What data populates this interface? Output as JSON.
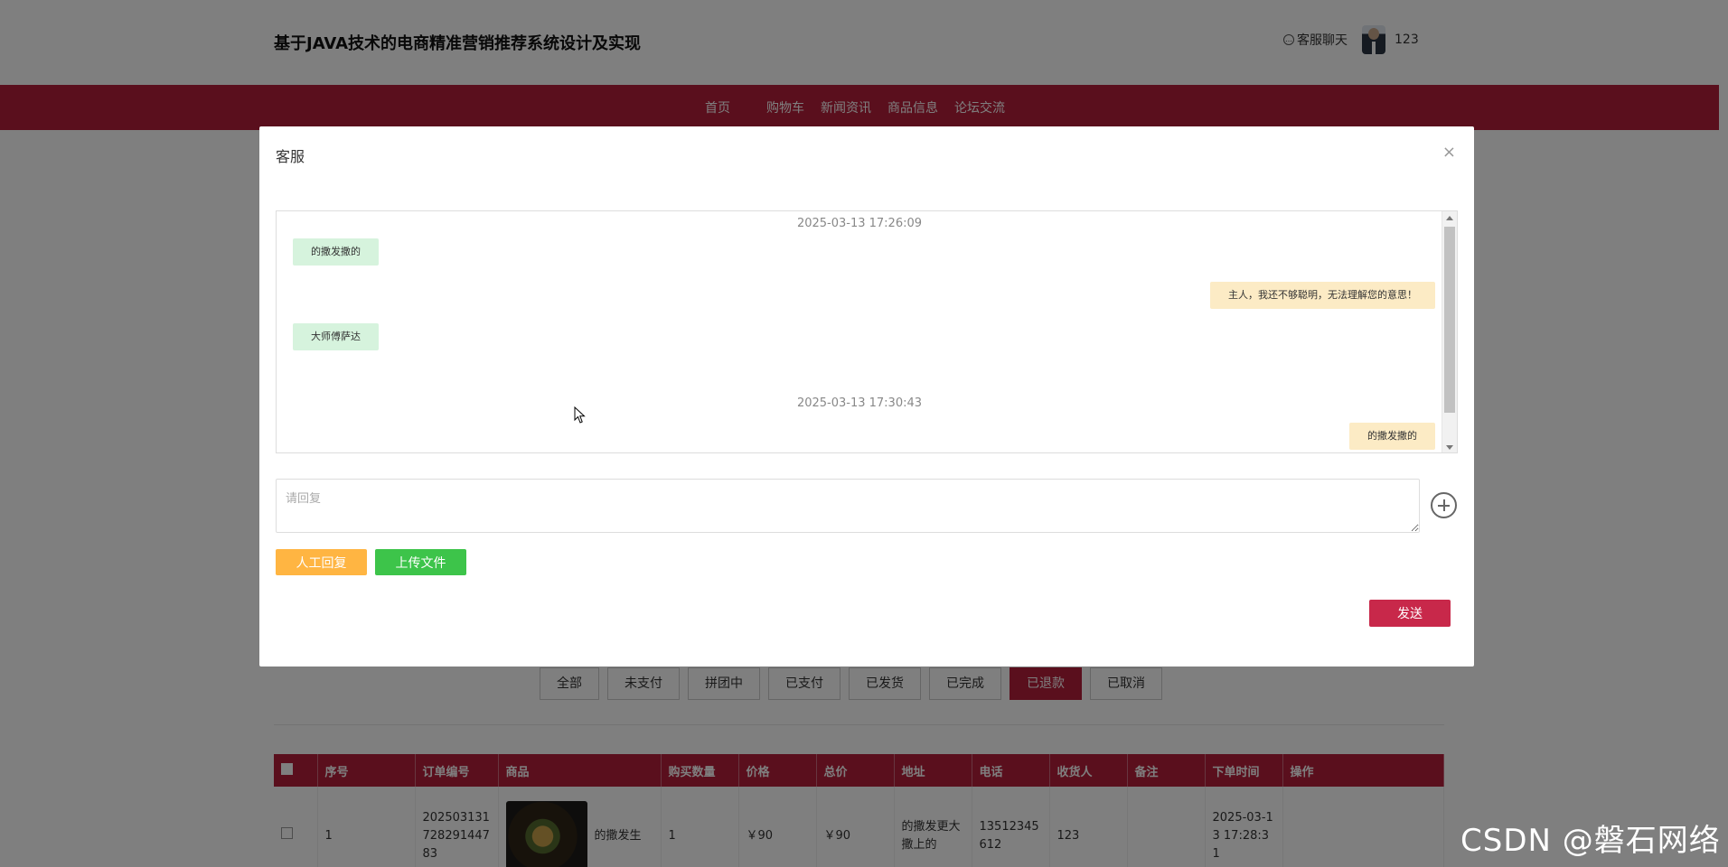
{
  "site": {
    "title": "基于JAVA技术的电商精准营销推荐系统设计及实现",
    "chat_label": "客服聊天",
    "username": "123"
  },
  "nav": [
    "首页",
    "购物车",
    "新闻资讯",
    "商品信息",
    "论坛交流"
  ],
  "order_tabs": [
    "全部",
    "未支付",
    "拼团中",
    "已支付",
    "已发货",
    "已完成",
    "已退款",
    "已取消"
  ],
  "order_tabs_active": "已退款",
  "order_table": {
    "headers": [
      "序号",
      "订单编号",
      "商品",
      "购买数量",
      "价格",
      "总价",
      "地址",
      "电话",
      "收货人",
      "备注",
      "下单时间",
      "操作"
    ],
    "rows": [
      {
        "index": "1",
        "order_no": "202503131728291447 83",
        "product": "的撒发生",
        "qty": "1",
        "price": "￥90",
        "total": "￥90",
        "address": "的撒发更大撒上的",
        "phone": "13512345 612",
        "receiver": "123",
        "remark": "",
        "time": "2025-03-1 3 17:28:31",
        "action": ""
      }
    ]
  },
  "modal": {
    "title": "客服",
    "close": "×",
    "messages": [
      {
        "type": "time",
        "text": "2025-03-13 17:26:09"
      },
      {
        "type": "left",
        "text": "的撒发撒的"
      },
      {
        "type": "right",
        "text": "主人，我还不够聪明，无法理解您的意思！"
      },
      {
        "type": "left",
        "text": "大师傅萨达"
      },
      {
        "type": "time",
        "text": "2025-03-13 17:30:43"
      },
      {
        "type": "right",
        "text": "的撒发撒的"
      }
    ],
    "reply_placeholder": "请回复",
    "manual_reply": "人工回复",
    "upload_file": "上传文件",
    "send": "发送"
  },
  "watermark": "CSDN @磐石网络",
  "colors": {
    "brand": "#b41f3a",
    "send_button": "#c8284a",
    "manual_button": "#ffb542",
    "upload_button": "#3dc44a",
    "user_bubble": "#d6f3dd",
    "bot_bubble": "#fcebc5"
  }
}
